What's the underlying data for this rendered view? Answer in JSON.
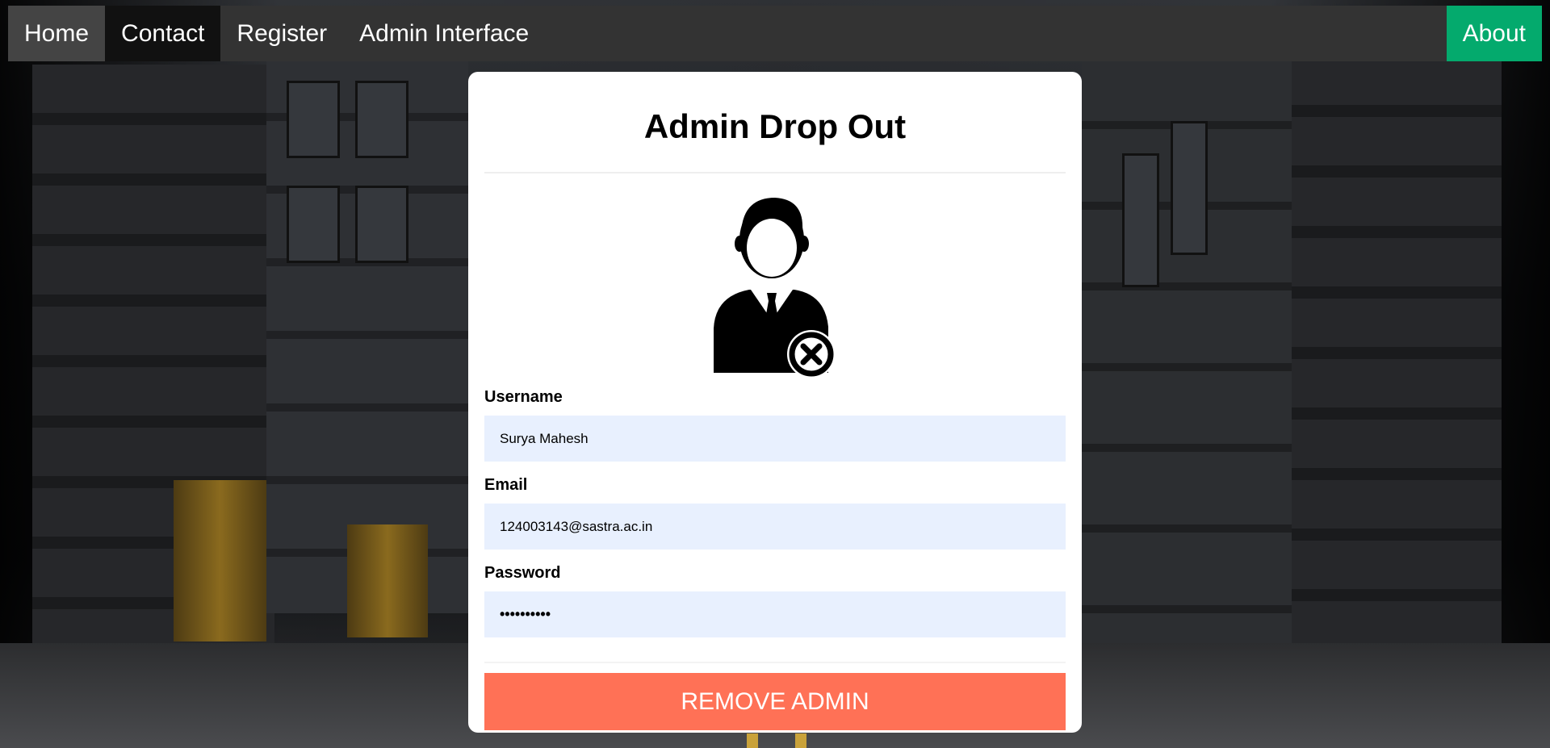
{
  "nav": {
    "home": "Home",
    "contact": "Contact",
    "register": "Register",
    "admin_interface": "Admin Interface",
    "about": "About"
  },
  "card": {
    "title": "Admin Drop Out",
    "avatar_icon": "admin-remove-icon",
    "username_label": "Username",
    "username_value": "Surya Mahesh",
    "email_label": "Email",
    "email_value": "124003143@sastra.ac.in",
    "password_label": "Password",
    "password_value": "••••••••••",
    "button_label": "REMOVE ADMIN"
  },
  "colors": {
    "navbar": "#333333",
    "about": "#04AA6D",
    "button": "#ff7156",
    "input_bg": "#e8f0fe"
  }
}
